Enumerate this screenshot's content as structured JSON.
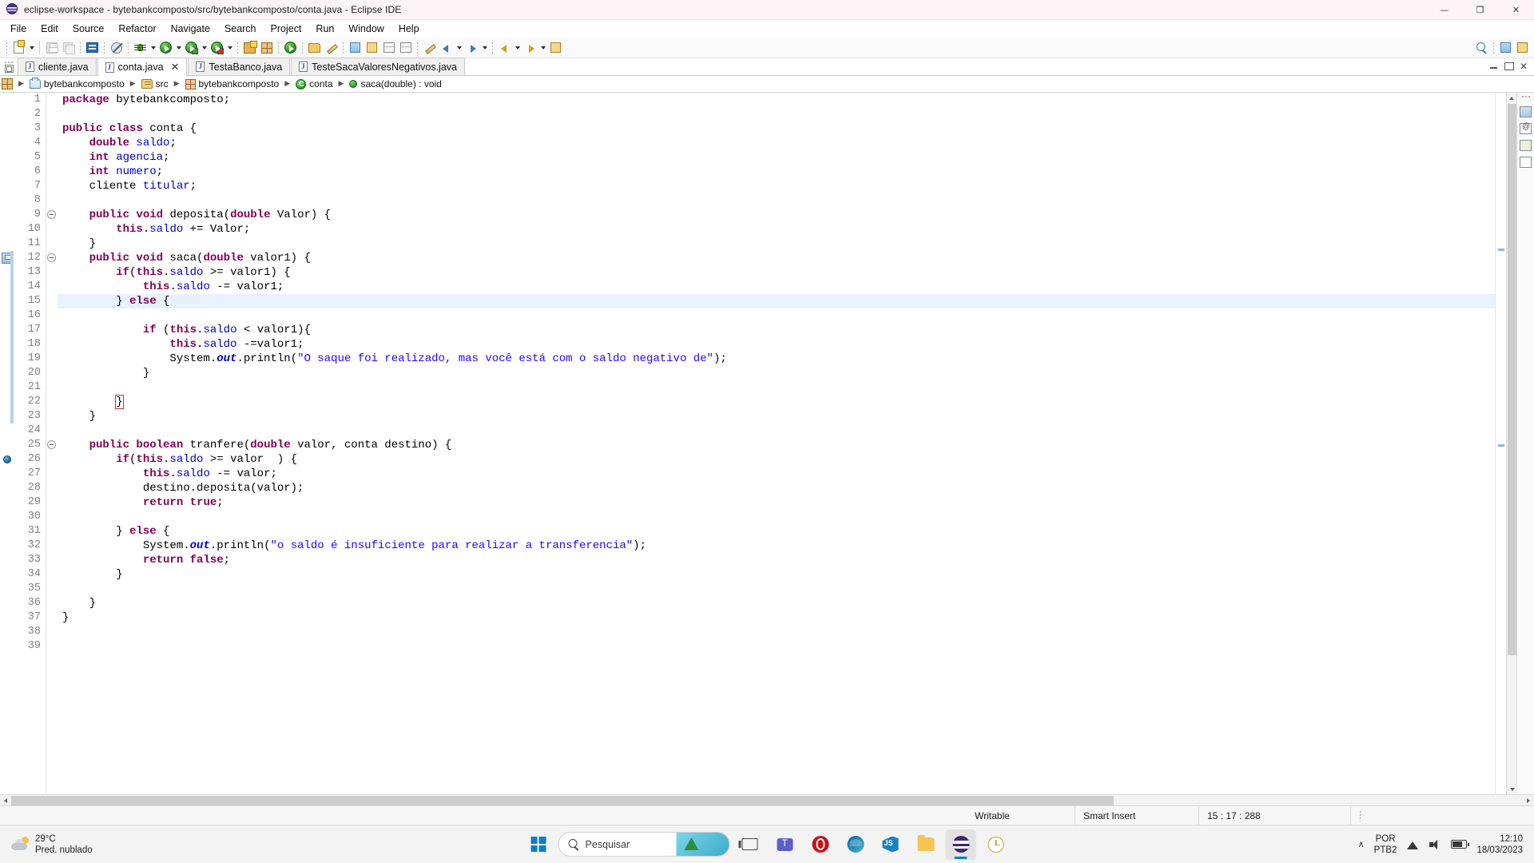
{
  "window": {
    "title": "eclipse-workspace - bytebankcomposto/src/bytebankcomposto/conta.java - Eclipse IDE",
    "minimize": "—",
    "maximize": "❐",
    "close": "✕"
  },
  "menu": {
    "items": [
      {
        "label": "File"
      },
      {
        "label": "Edit"
      },
      {
        "label": "Source"
      },
      {
        "label": "Refactor"
      },
      {
        "label": "Navigate"
      },
      {
        "label": "Search"
      },
      {
        "label": "Project"
      },
      {
        "label": "Run"
      },
      {
        "label": "Window"
      },
      {
        "label": "Help"
      }
    ]
  },
  "toolbar": {
    "icons": [
      "new-file-icon",
      "new-file-dropdown",
      "save-icon",
      "save-all-icon",
      "console-icon",
      "skip-breakpoints-icon",
      "debug-icon",
      "debug-dropdown",
      "run-icon",
      "run-dropdown",
      "coverage-icon",
      "coverage-dropdown",
      "run-last-tool-icon",
      "run-last-tool-dropdown",
      "new-wizard-icon",
      "open-type-icon",
      "search-icon",
      "back-icon",
      "forward-icon"
    ],
    "search_icon": "search-icon"
  },
  "tabs": {
    "items": [
      {
        "label": "cliente.java",
        "active": false,
        "closable": false
      },
      {
        "label": "conta.java",
        "active": true,
        "closable": true
      },
      {
        "label": "TestaBanco.java",
        "active": false,
        "closable": false
      },
      {
        "label": "TesteSacaValoresNegativos.java",
        "active": false,
        "closable": false
      }
    ],
    "close_glyph": "✕",
    "minimize_glyph": "—",
    "maximize_glyph": "❐"
  },
  "breadcrumb": {
    "separator": "▶",
    "items": [
      {
        "label": "bytebankcomposto",
        "icon": "java-project-icon"
      },
      {
        "label": "src",
        "icon": "source-folder-icon"
      },
      {
        "label": "bytebankcomposto",
        "icon": "package-icon"
      },
      {
        "label": "conta",
        "icon": "class-icon"
      },
      {
        "label": "saca(double) : void",
        "icon": "method-icon"
      }
    ]
  },
  "editor": {
    "file": "conta.java",
    "current_line": 15,
    "lines": [
      {
        "n": 1,
        "tokens": [
          {
            "t": "package ",
            "c": "kw"
          },
          {
            "t": "bytebankcomposto;",
            "c": "pl"
          }
        ]
      },
      {
        "n": 2,
        "tokens": []
      },
      {
        "n": 3,
        "tokens": [
          {
            "t": "public class ",
            "c": "kw"
          },
          {
            "t": "conta {",
            "c": "pl"
          }
        ]
      },
      {
        "n": 4,
        "tokens": [
          {
            "t": "    ",
            "c": "pl"
          },
          {
            "t": "double ",
            "c": "kw"
          },
          {
            "t": "saldo",
            "c": "fld"
          },
          {
            "t": ";",
            "c": "pl"
          }
        ]
      },
      {
        "n": 5,
        "tokens": [
          {
            "t": "    ",
            "c": "pl"
          },
          {
            "t": "int ",
            "c": "kw"
          },
          {
            "t": "agencia",
            "c": "fld"
          },
          {
            "t": ";",
            "c": "pl"
          }
        ]
      },
      {
        "n": 6,
        "tokens": [
          {
            "t": "    ",
            "c": "pl"
          },
          {
            "t": "int ",
            "c": "kw"
          },
          {
            "t": "numero",
            "c": "fld"
          },
          {
            "t": ";",
            "c": "pl"
          }
        ]
      },
      {
        "n": 7,
        "tokens": [
          {
            "t": "    cliente ",
            "c": "pl"
          },
          {
            "t": "titular",
            "c": "fld"
          },
          {
            "t": ";",
            "c": "pl"
          }
        ]
      },
      {
        "n": 8,
        "tokens": []
      },
      {
        "n": 9,
        "fold": true,
        "tokens": [
          {
            "t": "    ",
            "c": "pl"
          },
          {
            "t": "public void ",
            "c": "kw"
          },
          {
            "t": "deposita(",
            "c": "pl"
          },
          {
            "t": "double ",
            "c": "kw"
          },
          {
            "t": "Valor) {",
            "c": "pl"
          }
        ]
      },
      {
        "n": 10,
        "tokens": [
          {
            "t": "        ",
            "c": "pl"
          },
          {
            "t": "this",
            "c": "kw"
          },
          {
            "t": ".",
            "c": "pl"
          },
          {
            "t": "saldo",
            "c": "fld"
          },
          {
            "t": " += Valor;",
            "c": "pl"
          }
        ]
      },
      {
        "n": 11,
        "tokens": [
          {
            "t": "    }",
            "c": "pl"
          }
        ]
      },
      {
        "n": 12,
        "fold": true,
        "marker": "save-marker",
        "changed": true,
        "tokens": [
          {
            "t": "    ",
            "c": "pl"
          },
          {
            "t": "public void ",
            "c": "kw"
          },
          {
            "t": "saca(",
            "c": "pl"
          },
          {
            "t": "double ",
            "c": "kw"
          },
          {
            "t": "valor1) {",
            "c": "pl"
          }
        ]
      },
      {
        "n": 13,
        "changed": true,
        "tokens": [
          {
            "t": "        ",
            "c": "pl"
          },
          {
            "t": "if",
            "c": "kw"
          },
          {
            "t": "(",
            "c": "pl"
          },
          {
            "t": "this",
            "c": "kw"
          },
          {
            "t": ".",
            "c": "pl"
          },
          {
            "t": "saldo",
            "c": "fld"
          },
          {
            "t": " >= valor1) {",
            "c": "pl"
          }
        ]
      },
      {
        "n": 14,
        "changed": true,
        "tokens": [
          {
            "t": "            ",
            "c": "pl"
          },
          {
            "t": "this",
            "c": "kw"
          },
          {
            "t": ".",
            "c": "pl"
          },
          {
            "t": "saldo",
            "c": "fld"
          },
          {
            "t": " -= valor1;",
            "c": "pl"
          }
        ]
      },
      {
        "n": 15,
        "changed": true,
        "highlight": true,
        "tokens": [
          {
            "t": "        } ",
            "c": "pl"
          },
          {
            "t": "else",
            "c": "kw"
          },
          {
            "t": " {",
            "c": "pl"
          }
        ]
      },
      {
        "n": 16,
        "changed": true,
        "tokens": []
      },
      {
        "n": 17,
        "changed": true,
        "tokens": [
          {
            "t": "            ",
            "c": "pl"
          },
          {
            "t": "if",
            "c": "kw"
          },
          {
            "t": " (",
            "c": "pl"
          },
          {
            "t": "this",
            "c": "kw"
          },
          {
            "t": ".",
            "c": "pl"
          },
          {
            "t": "saldo",
            "c": "fld"
          },
          {
            "t": " < valor1){",
            "c": "pl"
          }
        ]
      },
      {
        "n": 18,
        "changed": true,
        "tokens": [
          {
            "t": "                ",
            "c": "pl"
          },
          {
            "t": "this",
            "c": "kw"
          },
          {
            "t": ".",
            "c": "pl"
          },
          {
            "t": "saldo",
            "c": "fld"
          },
          {
            "t": " -=valor1;",
            "c": "pl"
          }
        ]
      },
      {
        "n": 19,
        "changed": true,
        "tokens": [
          {
            "t": "                System.",
            "c": "pl"
          },
          {
            "t": "out",
            "c": "stat"
          },
          {
            "t": ".println(",
            "c": "pl"
          },
          {
            "t": "\"O saque foi realizado, mas você está com o saldo negativo de\"",
            "c": "str"
          },
          {
            "t": ");",
            "c": "pl"
          }
        ]
      },
      {
        "n": 20,
        "changed": true,
        "tokens": [
          {
            "t": "            }",
            "c": "pl"
          }
        ]
      },
      {
        "n": 21,
        "changed": true,
        "tokens": []
      },
      {
        "n": 22,
        "changed": true,
        "brace": true,
        "tokens": [
          {
            "t": "        }",
            "c": "pl"
          }
        ]
      },
      {
        "n": 23,
        "changed": true,
        "tokens": [
          {
            "t": "    }",
            "c": "pl"
          }
        ]
      },
      {
        "n": 24,
        "tokens": []
      },
      {
        "n": 25,
        "fold": true,
        "tokens": [
          {
            "t": "    ",
            "c": "pl"
          },
          {
            "t": "public boolean ",
            "c": "kw"
          },
          {
            "t": "tranfere(",
            "c": "pl"
          },
          {
            "t": "double ",
            "c": "kw"
          },
          {
            "t": "valor, conta destino) {",
            "c": "pl"
          }
        ]
      },
      {
        "n": 26,
        "marker": "breakpoint",
        "tokens": [
          {
            "t": "        ",
            "c": "pl"
          },
          {
            "t": "if",
            "c": "kw"
          },
          {
            "t": "(",
            "c": "pl"
          },
          {
            "t": "this",
            "c": "kw"
          },
          {
            "t": ".",
            "c": "pl"
          },
          {
            "t": "saldo",
            "c": "fld"
          },
          {
            "t": " >= valor  ) {",
            "c": "pl"
          }
        ]
      },
      {
        "n": 27,
        "tokens": [
          {
            "t": "            ",
            "c": "pl"
          },
          {
            "t": "this",
            "c": "kw"
          },
          {
            "t": ".",
            "c": "pl"
          },
          {
            "t": "saldo",
            "c": "fld"
          },
          {
            "t": " -= valor;",
            "c": "pl"
          }
        ]
      },
      {
        "n": 28,
        "tokens": [
          {
            "t": "            destino.",
            "c": "pl"
          },
          {
            "t": "deposita",
            "c": "pl"
          },
          {
            "t": "(valor);",
            "c": "pl"
          }
        ]
      },
      {
        "n": 29,
        "tokens": [
          {
            "t": "            ",
            "c": "pl"
          },
          {
            "t": "return true",
            "c": "kw"
          },
          {
            "t": ";",
            "c": "pl"
          }
        ]
      },
      {
        "n": 30,
        "tokens": []
      },
      {
        "n": 31,
        "tokens": [
          {
            "t": "        } ",
            "c": "pl"
          },
          {
            "t": "else",
            "c": "kw"
          },
          {
            "t": " {",
            "c": "pl"
          }
        ]
      },
      {
        "n": 32,
        "tokens": [
          {
            "t": "            System.",
            "c": "pl"
          },
          {
            "t": "out",
            "c": "stat"
          },
          {
            "t": ".println(",
            "c": "pl"
          },
          {
            "t": "\"o saldo é insuficiente para realizar a transferencia\"",
            "c": "str"
          },
          {
            "t": ");",
            "c": "pl"
          }
        ]
      },
      {
        "n": 33,
        "tokens": [
          {
            "t": "            ",
            "c": "pl"
          },
          {
            "t": "return false",
            "c": "kw"
          },
          {
            "t": ";",
            "c": "pl"
          }
        ]
      },
      {
        "n": 34,
        "tokens": [
          {
            "t": "        }",
            "c": "pl"
          }
        ]
      },
      {
        "n": 35,
        "tokens": []
      },
      {
        "n": 36,
        "tokens": [
          {
            "t": "    }",
            "c": "pl"
          }
        ]
      },
      {
        "n": 37,
        "tokens": [
          {
            "t": "}",
            "c": "pl"
          }
        ]
      },
      {
        "n": 38,
        "tokens": []
      },
      {
        "n": 39,
        "tokens": []
      }
    ]
  },
  "status": {
    "writable": "Writable",
    "insert_mode": "Smart Insert",
    "position": "15 : 17 : 288"
  },
  "taskbar": {
    "weather_temp": "29°C",
    "weather_desc": "Pred. nublado",
    "search_placeholder": "Pesquisar",
    "language_top": "POR",
    "language_bottom": "PTB2",
    "clock_time": "12:10",
    "clock_date": "18/03/2023",
    "chevron": "∧",
    "apps": [
      {
        "name": "start-button",
        "icon": "windows-logo-icon"
      },
      {
        "name": "task-view",
        "icon": "task-view-icon"
      },
      {
        "name": "teams",
        "icon": "teams-icon"
      },
      {
        "name": "opera",
        "icon": "opera-icon"
      },
      {
        "name": "edge",
        "icon": "edge-icon"
      },
      {
        "name": "vscode",
        "icon": "vscode-icon"
      },
      {
        "name": "file-explorer",
        "icon": "folder-icon"
      },
      {
        "name": "eclipse",
        "icon": "eclipse-icon"
      },
      {
        "name": "clock-app",
        "icon": "clock-icon"
      }
    ]
  },
  "colors": {
    "keyword": "#7f0055",
    "field": "#0000c0",
    "string": "#2a00ff",
    "highlight_line": "#e8f2fc",
    "accent": "#0d7ec4"
  }
}
